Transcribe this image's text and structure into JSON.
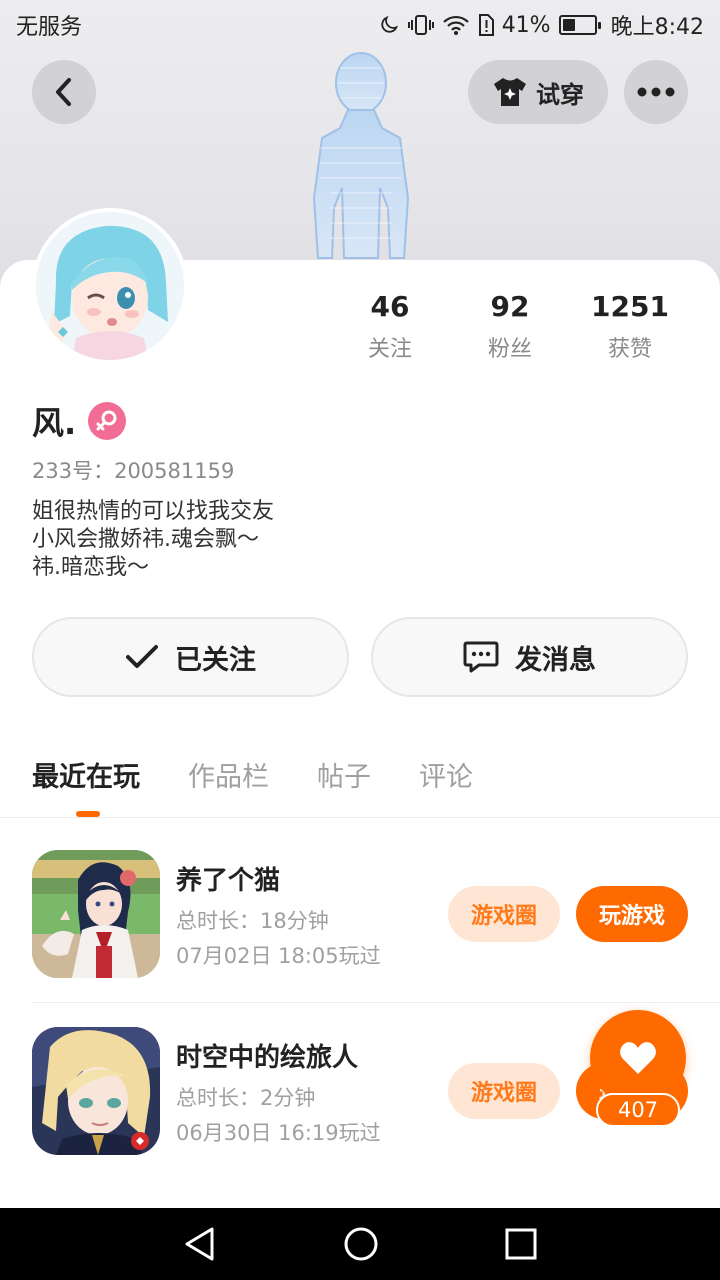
{
  "status_bar": {
    "carrier": "无服务",
    "battery_percent": "41%",
    "battery_level": 0.41,
    "time": "晚上8:42"
  },
  "header": {
    "tryon_label": "试穿"
  },
  "profile": {
    "stats": [
      {
        "value": "46",
        "label": "关注"
      },
      {
        "value": "92",
        "label": "粉丝"
      },
      {
        "value": "1251",
        "label": "获赞"
      }
    ],
    "username": "风.",
    "user_id": "233号：200581159",
    "bio": [
      "姐很热情的可以找我交友",
      "小风会撒娇祎.魂会飘～",
      "祎.暗恋我～"
    ]
  },
  "actions": {
    "follow_label": "已关注",
    "message_label": "发消息"
  },
  "tabs": [
    {
      "label": "最近在玩",
      "active": true
    },
    {
      "label": "作品栏",
      "active": false
    },
    {
      "label": "帖子",
      "active": false
    },
    {
      "label": "评论",
      "active": false
    }
  ],
  "games": [
    {
      "name": "养了个猫",
      "duration": "总时长：18分钟",
      "last_played": "07月02日 18:05玩过",
      "circle_label": "游戏圈",
      "play_label": "玩游戏"
    },
    {
      "name": "时空中的绘旅人",
      "duration": "总时长：2分钟",
      "last_played": "06月30日 16:19玩过",
      "circle_label": "游戏圈",
      "play_label": "玩游戏"
    }
  ],
  "like_fab": {
    "count": "407"
  },
  "colors": {
    "accent": "#ff6a00",
    "tag_bg": "#ffe6d4",
    "gender_badge": "#f26d96"
  }
}
